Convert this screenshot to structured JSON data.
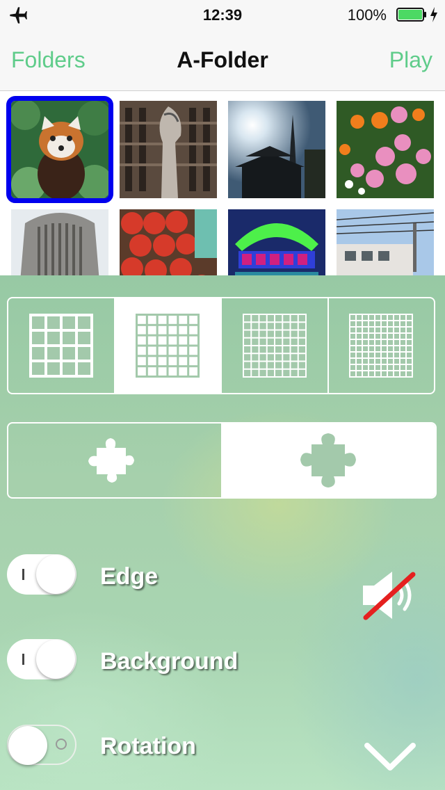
{
  "status_bar": {
    "time": "12:39",
    "battery_percent": "100%",
    "battery_color": "#4cd964"
  },
  "nav": {
    "left_button": "Folders",
    "title": "A-Folder",
    "right_button": "Play",
    "accent_color": "#5fcc8a"
  },
  "thumbnails": [
    {
      "name": "red-panda",
      "selected": true
    },
    {
      "name": "sculpture-building"
    },
    {
      "name": "temple-tower-sun"
    },
    {
      "name": "flowers"
    },
    {
      "name": "tall-building"
    },
    {
      "name": "apples"
    },
    {
      "name": "neon-sign"
    },
    {
      "name": "train"
    }
  ],
  "grid_size_options": [
    {
      "icon": "grid-4x4-icon"
    },
    {
      "icon": "grid-6x6-icon",
      "active": true
    },
    {
      "icon": "grid-8x8-icon"
    },
    {
      "icon": "grid-10x10-icon"
    }
  ],
  "piece_shape_options": [
    {
      "icon": "puzzle-piece-small-icon"
    },
    {
      "icon": "puzzle-piece-large-icon",
      "active": true
    }
  ],
  "toggles": [
    {
      "label": "Edge",
      "state": "on"
    },
    {
      "label": "Background",
      "state": "on"
    },
    {
      "label": "Rotation",
      "state": "off"
    }
  ],
  "sound": {
    "icon": "speaker-muted-icon",
    "muted": true
  },
  "collapse": {
    "icon": "chevron-down-icon"
  }
}
